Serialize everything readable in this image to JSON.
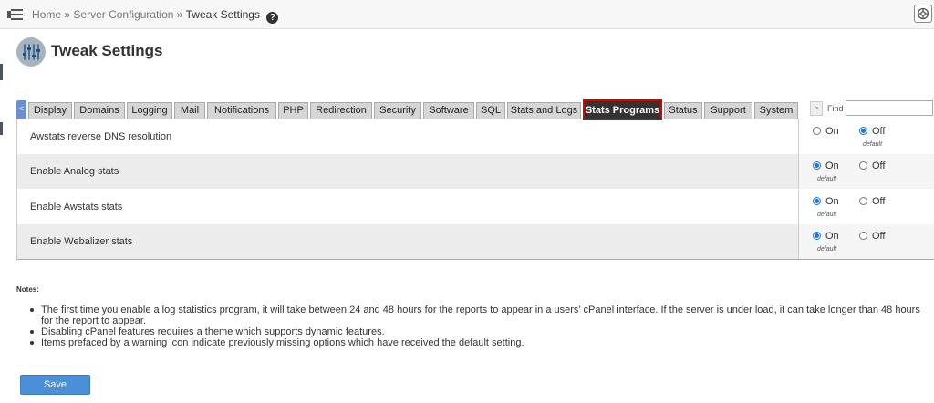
{
  "breadcrumb": {
    "home": "Home",
    "sep1": "»",
    "section": "Server Configuration",
    "sep2": "»",
    "current": "Tweak Settings",
    "help_glyph": "?"
  },
  "page": {
    "title": "Tweak Settings"
  },
  "tabs": {
    "scroll_left": "<",
    "scroll_right": ">",
    "items": [
      "Display",
      "Domains",
      "Logging",
      "Mail",
      "Notifications",
      "PHP",
      "Redirection",
      "Security",
      "Software",
      "SQL",
      "Stats and Logs",
      "Stats Programs",
      "Status",
      "Support",
      "System"
    ],
    "active": "Stats Programs",
    "find_label": "Find",
    "find_value": ""
  },
  "settings": [
    {
      "label": "Awstats reverse DNS resolution",
      "on_label": "On",
      "off_label": "Off",
      "selected": "off",
      "default_tag": "default",
      "default_for": "off"
    },
    {
      "label": "Enable Analog stats",
      "on_label": "On",
      "off_label": "Off",
      "selected": "on",
      "default_tag": "default",
      "default_for": "on"
    },
    {
      "label": "Enable Awstats stats",
      "on_label": "On",
      "off_label": "Off",
      "selected": "on",
      "default_tag": "default",
      "default_for": "on"
    },
    {
      "label": "Enable Webalizer stats",
      "on_label": "On",
      "off_label": "Off",
      "selected": "on",
      "default_tag": "default",
      "default_for": "on"
    }
  ],
  "notes": {
    "title": "Notes:",
    "items": [
      "The first time you enable a log statistics program, it will take between 24 and 48 hours for the reports to appear in a users’ cPanel interface. If the server is under load, it can take longer than 48 hours for the report to appear.",
      "Disabling cPanel features requires a theme which supports dynamic features.",
      "Items prefaced by a warning icon indicate previously missing options which have received the default setting."
    ]
  },
  "save_label": "Save",
  "colors": {
    "active_tab_bg": "#333333",
    "active_tab_outline": "#dd0000",
    "radio_accent": "#1a73e8",
    "save_button": "#4a8fd8"
  },
  "icons": {
    "menu": "menu-toggle-icon",
    "help": "help-circle-icon",
    "globe": "globe-icon",
    "app": "tweak-settings-sliders-icon"
  }
}
